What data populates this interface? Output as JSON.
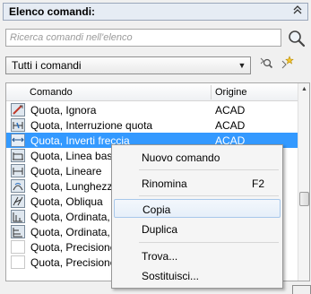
{
  "panel": {
    "title": "Elenco comandi:",
    "collapse_glyph": "»"
  },
  "search": {
    "placeholder": "Ricerca comandi nell'elenco",
    "icon": "search-icon"
  },
  "filter": {
    "selected": "Tutti i comandi",
    "icons": [
      "find-icon",
      "new-command-icon"
    ]
  },
  "table": {
    "columns": [
      "Comando",
      "Origine"
    ],
    "rows": [
      {
        "cmd": "Quota, Ignora",
        "org": "ACAD",
        "selected": false
      },
      {
        "cmd": "Quota, Interruzione quota",
        "org": "ACAD",
        "selected": false
      },
      {
        "cmd": "Quota, Inverti freccia",
        "org": "ACAD",
        "selected": true
      },
      {
        "cmd": "Quota, Linea base",
        "org": "",
        "selected": false
      },
      {
        "cmd": "Quota, Lineare",
        "org": "",
        "selected": false
      },
      {
        "cmd": "Quota, Lunghezza",
        "org": "",
        "selected": false
      },
      {
        "cmd": "Quota, Obliqua",
        "org": "",
        "selected": false
      },
      {
        "cmd": "Quota, Ordinata, X",
        "org": "",
        "selected": false
      },
      {
        "cmd": "Quota, Ordinata, Y",
        "org": "",
        "selected": false
      },
      {
        "cmd": "Quota, Precisione,",
        "org": "",
        "selected": false
      },
      {
        "cmd": "Quota, Precisione,",
        "org": "",
        "selected": false
      }
    ]
  },
  "context_menu": {
    "items": [
      {
        "label": "Nuovo comando",
        "shortcut": ""
      },
      {
        "label": "Rinomina",
        "shortcut": "F2"
      },
      {
        "label": "Copia",
        "shortcut": "",
        "highlighted": true
      },
      {
        "label": "Duplica",
        "shortcut": ""
      },
      {
        "label": "Trova...",
        "shortcut": ""
      },
      {
        "label": "Sostituisci...",
        "shortcut": ""
      }
    ]
  },
  "colors": {
    "selection": "#3399ff",
    "header_bg": "#e6ecf4",
    "menu_highlight_border": "#a8c8ea"
  }
}
